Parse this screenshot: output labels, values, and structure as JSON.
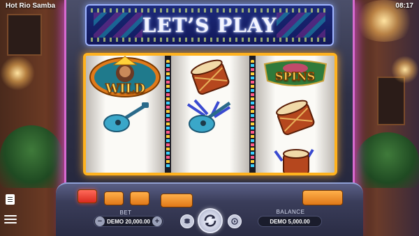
{
  "app": {
    "title": "Hot Rio Samba",
    "clock": "08:17"
  },
  "marquee": {
    "title": "LET’S PLAY"
  },
  "reels": {
    "columns": [
      {
        "rows": [
          "wild-symbol",
          "ukulele-symbol",
          "empty"
        ]
      },
      {
        "rows": [
          "drum-symbol",
          "ukulele-feather-symbol",
          "empty"
        ]
      },
      {
        "rows": [
          "free-spins-symbol",
          "drum-symbol",
          "drum-symbol"
        ]
      }
    ],
    "wild_label": "WILD",
    "spins_label": "SPINS"
  },
  "controls": {
    "bet_label": "BET",
    "bet_value": "DEMO 20,000.00",
    "balance_label": "BALANCE",
    "balance_value": "DEMO 5,000.00",
    "minus": "−",
    "plus": "+"
  },
  "colors": {
    "frame": "#ffb21e",
    "neon": "#d66ad0",
    "marquee_bg": "#12185a"
  }
}
